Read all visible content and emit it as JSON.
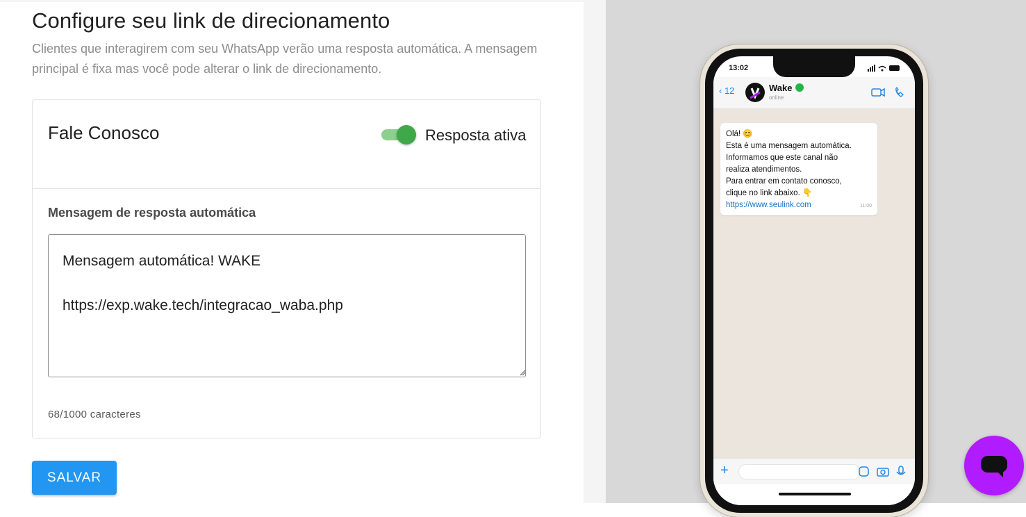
{
  "header": {
    "title": "Configure seu link de direcionamento",
    "subtitle": "Clientes que interagirem com seu WhatsApp verão uma resposta automática. A mensagem principal é fixa mas você pode alterar o link de direcionamento."
  },
  "card": {
    "title": "Fale Conosco",
    "toggle": {
      "label": "Resposta ativa",
      "on": true,
      "color": "#3fa848"
    },
    "field_label": "Mensagem de resposta automática",
    "message": "Mensagem automática! WAKE\n\nhttps://exp.wake.tech/integracao_waba.php",
    "counter": "68/1000 caracteres"
  },
  "actions": {
    "save_label": "SALVAR",
    "color": "#2196f3"
  },
  "preview": {
    "status_time": "13:02",
    "back_count": "12",
    "contact_name": "Wake",
    "contact_status": "online",
    "bubble_lines": [
      "Olá! 😊",
      "Esta é uma mensagem automática.",
      "Informamos que este canal não",
      "realiza atendimentos.",
      "Para entrar em contato conosco,",
      "clique no link abaixo. 👇"
    ],
    "bubble_link": "https://www.seulink.com",
    "bubble_time": "11:00"
  },
  "chat_fab": {
    "icon": "chat-bubble-icon",
    "color": "#b11bff"
  }
}
